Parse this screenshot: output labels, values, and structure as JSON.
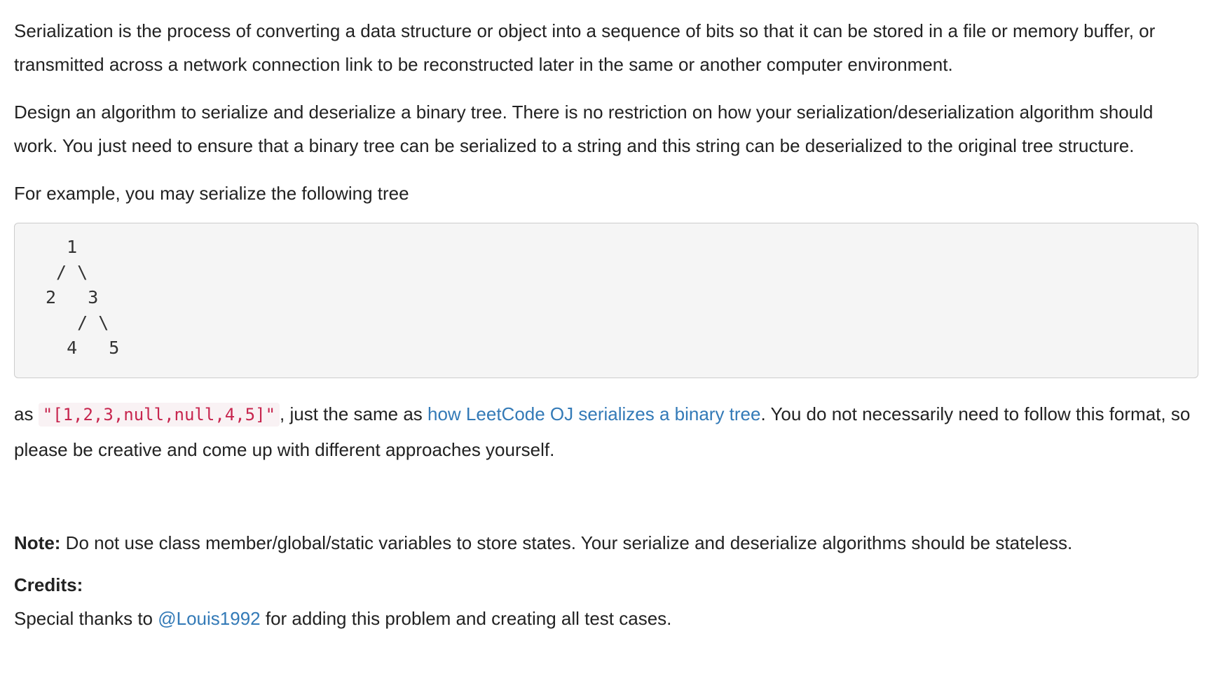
{
  "intro": "Serialization is the process of converting a data structure or object into a sequence of bits so that it can be stored in a file or memory buffer, or transmitted across a network connection link to be reconstructed later in the same or another computer environment.",
  "design": "Design an algorithm to serialize and deserialize a binary tree. There is no restriction on how your serialization/deserialization algorithm should work. You just need to ensure that a binary tree can be serialized to a string and this string can be deserialized to the original tree structure.",
  "example_lead": "For example, you may serialize the following tree",
  "tree_ascii": "  1\n / \\\n2   3\n   / \\\n  4   5",
  "as_text": {
    "prefix": "as ",
    "code": "\"[1,2,3,null,null,4,5]\"",
    "middle": ", just the same as ",
    "link": "how LeetCode OJ serializes a binary tree",
    "suffix": ". You do not necessarily need to follow this format, so please be creative and come up with different approaches yourself."
  },
  "note": {
    "label": "Note:",
    "text": " Do not use class member/global/static variables to store states. Your serialize and deserialize algorithms should be stateless."
  },
  "credits": {
    "label": "Credits:",
    "prefix": "Special thanks to ",
    "user_link": "@Louis1992",
    "suffix": " for adding this problem and creating all test cases."
  },
  "colors": {
    "link": "#337ab7",
    "code_text": "#c7254e",
    "code_bg": "#f9f2f4",
    "pre_bg": "#f5f5f5"
  }
}
